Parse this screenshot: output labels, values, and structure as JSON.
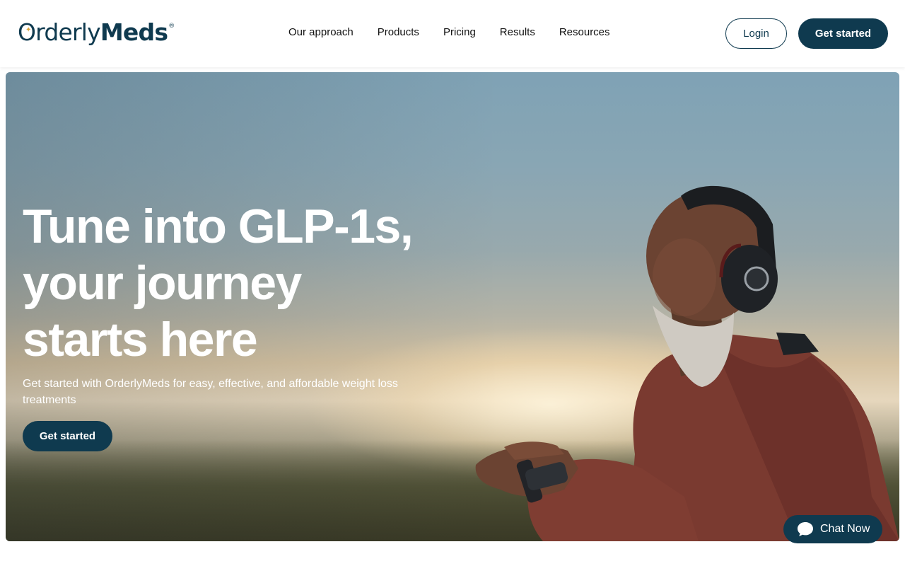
{
  "brand": {
    "name_light": "Orderly",
    "name_bold": "Meds",
    "registered": "®"
  },
  "nav": {
    "items": [
      "Our approach",
      "Products",
      "Pricing",
      "Results",
      "Resources"
    ]
  },
  "header": {
    "login_label": "Login",
    "get_started_label": "Get started"
  },
  "hero": {
    "title": "Tune into GLP-1s, your journey starts here",
    "subtitle": "Get started with OrderlyMeds for easy, effective, and  affordable weight loss treatments",
    "cta_label": "Get started"
  },
  "chat": {
    "label": "Chat Now"
  },
  "colors": {
    "brand_navy": "#0f3a4f",
    "accent_gold": "#d8a43b"
  }
}
